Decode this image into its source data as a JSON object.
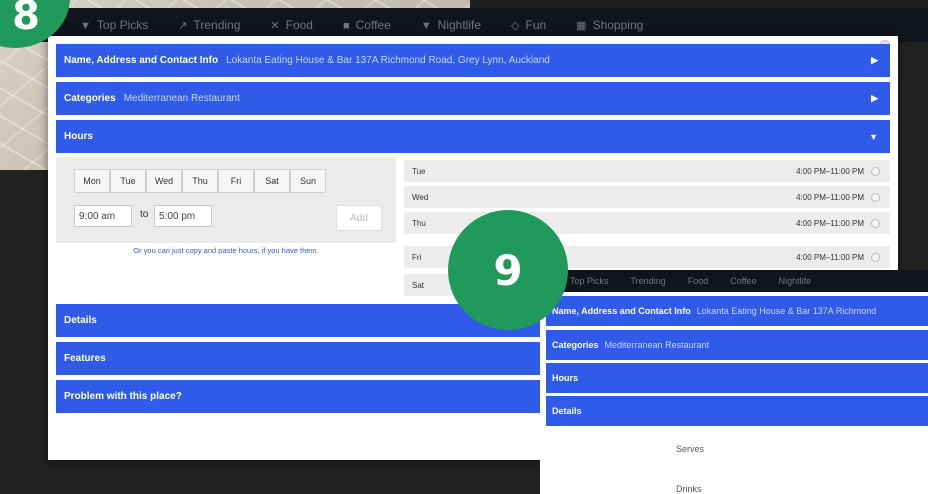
{
  "nav": {
    "items": [
      {
        "icon": "filter-icon",
        "glyph": "▼",
        "label": "Top Picks"
      },
      {
        "icon": "trending-icon",
        "glyph": "↗",
        "label": "Trending"
      },
      {
        "icon": "food-icon",
        "glyph": "✕",
        "label": "Food"
      },
      {
        "icon": "coffee-icon",
        "glyph": "■",
        "label": "Coffee"
      },
      {
        "icon": "nightlife-icon",
        "glyph": "▼",
        "label": "Nightlife"
      },
      {
        "icon": "fun-icon",
        "glyph": "◇",
        "label": "Fun"
      },
      {
        "icon": "shopping-icon",
        "glyph": "▦",
        "label": "Shopping"
      }
    ]
  },
  "modal": {
    "name_label": "Name, Address and Contact Info",
    "name_value": "Lokanta Eating House & Bar 137A Richmond Road, Grey Lynn, Auckland",
    "categories_label": "Categories",
    "categories_value": "Mediterranean Restaurant",
    "hours_label": "Hours",
    "details_label": "Details",
    "features_label": "Features",
    "problem_label": "Problem with this place?",
    "arrow_right": "▶",
    "arrow_down": "▼"
  },
  "hours_editor": {
    "days": [
      "Mon",
      "Tue",
      "Wed",
      "Thu",
      "Fri",
      "Sat",
      "Sun"
    ],
    "open_time": "9:00 am",
    "to_label": "to",
    "close_time": "5:00 pm",
    "add_label": "Add",
    "hint": "Or you can just copy and paste hours, if you have them."
  },
  "hours_list": [
    {
      "day": "Tue",
      "time": "4:00 PM–11:00 PM"
    },
    {
      "day": "Wed",
      "time": "4:00 PM–11:00 PM"
    },
    {
      "day": "Thu",
      "time": "4:00 PM–11:00 PM"
    },
    {
      "day": "Fri",
      "time": "4:00 PM–11:00 PM"
    },
    {
      "day": "Sat",
      "time": ""
    }
  ],
  "modal2": {
    "nav_items": [
      "Top Picks",
      "Trending",
      "Food",
      "Coffee",
      "Nightlife"
    ],
    "name_label": "Name, Address and Contact Info",
    "name_value": "Lokanta Eating House & Bar 137A Richmond",
    "categories_label": "Categories",
    "categories_value": "Mediterranean Restaurant",
    "hours_label": "Hours",
    "details_label": "Details",
    "serves_label": "Serves",
    "drinks_label": "Drinks"
  },
  "badges": {
    "step8": "8",
    "step9": "9"
  },
  "colors": {
    "accent_blue": "#2f5be8",
    "badge_green": "#1f9a5b",
    "nav_bg": "#10141d"
  }
}
